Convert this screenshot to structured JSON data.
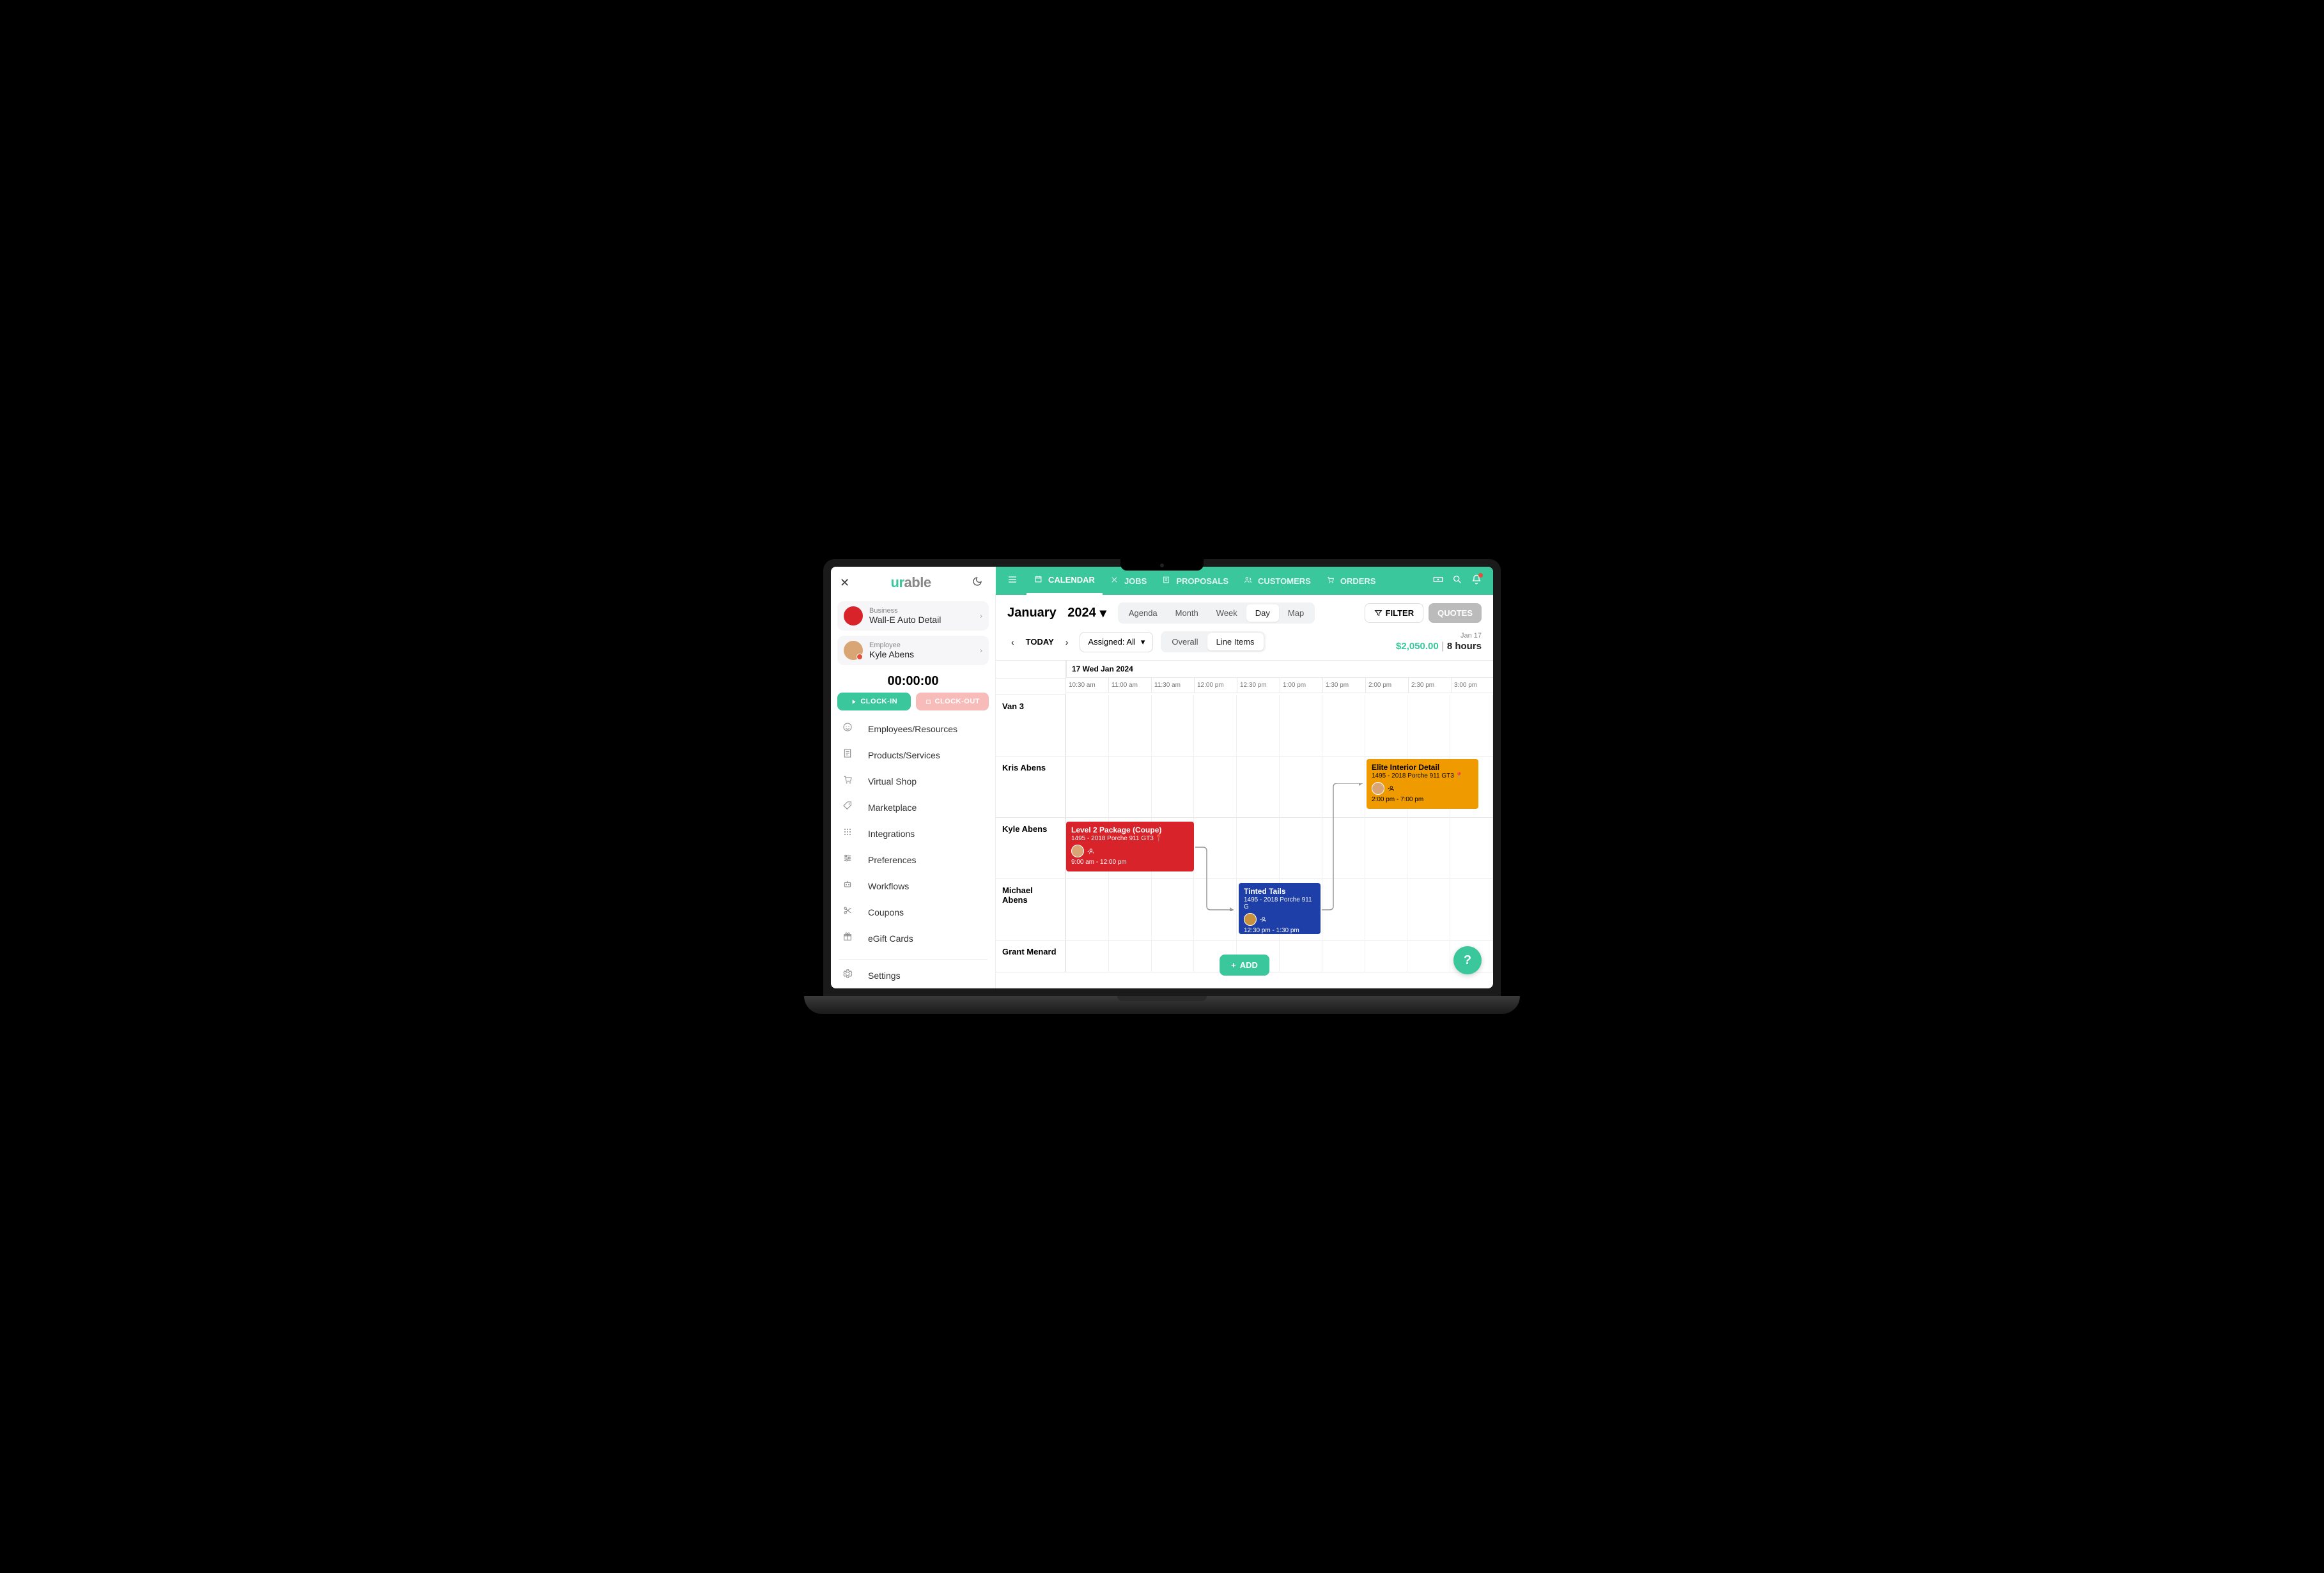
{
  "app": {
    "logo1": "ur",
    "logo2": "able"
  },
  "business": {
    "label": "Business",
    "name": "Wall-E Auto Detail"
  },
  "employee": {
    "label": "Employee",
    "name": "Kyle Abens"
  },
  "clock": {
    "timer": "00:00:00",
    "in": "CLOCK-IN",
    "out": "CLOCK-OUT"
  },
  "nav": [
    {
      "icon": "face",
      "label": "Employees/Resources"
    },
    {
      "icon": "doc",
      "label": "Products/Services"
    },
    {
      "icon": "cart",
      "label": "Virtual Shop"
    },
    {
      "icon": "tag",
      "label": "Marketplace"
    },
    {
      "icon": "grid",
      "label": "Integrations"
    },
    {
      "icon": "sliders",
      "label": "Preferences"
    },
    {
      "icon": "robot",
      "label": "Workflows"
    },
    {
      "icon": "scissors",
      "label": "Coupons"
    },
    {
      "icon": "gift",
      "label": "eGift Cards"
    }
  ],
  "settings": {
    "label": "Settings"
  },
  "tabs": [
    {
      "label": "CALENDAR",
      "active": true
    },
    {
      "label": "JOBS"
    },
    {
      "label": "PROPOSALS"
    },
    {
      "label": "CUSTOMERS"
    },
    {
      "label": "ORDERS"
    }
  ],
  "header": {
    "month": "January",
    "year": "2024"
  },
  "views": [
    "Agenda",
    "Month",
    "Week",
    "Day",
    "Map"
  ],
  "active_view": "Day",
  "filter": "FILTER",
  "quotes": "QUOTES",
  "today": "TODAY",
  "assigned": "Assigned: All",
  "scope": [
    "Overall",
    "Line Items"
  ],
  "active_scope": "Line Items",
  "stats": {
    "date": "Jan 17",
    "revenue": "$2,050.00",
    "hours": "8 hours"
  },
  "calendar": {
    "date_header": "17 Wed Jan 2024",
    "times": [
      "10:30 am",
      "11:00 am",
      "11:30 am",
      "12:00 pm",
      "12:30 pm",
      "1:00 pm",
      "1:30 pm",
      "2:00 pm",
      "2:30 pm",
      "3:00 pm"
    ],
    "resources": [
      "Van 3",
      "Kris Abens",
      "Kyle Abens",
      "Michael Abens",
      "Grant Menard"
    ]
  },
  "events": {
    "red": {
      "title": "Level 2 Package (Coupe)",
      "sub": "1495 - 2018 Porche 911 GT3",
      "time": "9:00 am - 12:00 pm"
    },
    "blue": {
      "title": "Tinted Tails",
      "sub": "1495 - 2018 Porche 911 G",
      "time": "12:30 pm - 1:30 pm"
    },
    "orange": {
      "title": "Elite Interior Detail",
      "sub": "1495 - 2018 Porche 911 GT3",
      "time": "2:00 pm - 7:00 pm"
    }
  },
  "add": "ADD",
  "help": "?"
}
